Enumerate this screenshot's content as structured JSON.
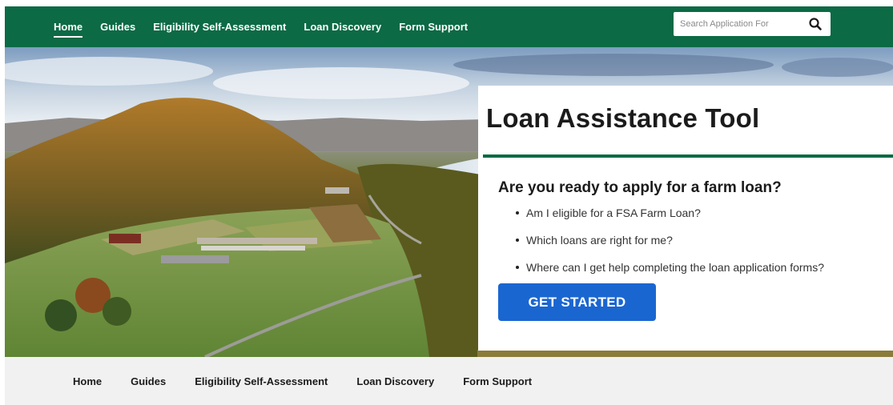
{
  "topnav": {
    "items": [
      {
        "label": "Home",
        "active": true
      },
      {
        "label": "Guides"
      },
      {
        "label": "Eligibility Self-Assessment"
      },
      {
        "label": "Loan Discovery"
      },
      {
        "label": "Form Support"
      }
    ],
    "search": {
      "placeholder": "Search Application For",
      "button_icon": "search-icon"
    }
  },
  "hero": {
    "image": "aerial farm landscape with mountain and river",
    "card": {
      "title": "Loan Assistance Tool",
      "question": "Are you ready to apply for a farm loan?",
      "bullets": [
        "Am I eligible for a FSA Farm Loan?",
        "Which loans are right for me?",
        "Where can I get help completing the loan application forms?"
      ],
      "cta_label": "GET STARTED"
    }
  },
  "footnav": {
    "items": [
      {
        "label": "Home"
      },
      {
        "label": "Guides"
      },
      {
        "label": "Eligibility Self-Assessment"
      },
      {
        "label": "Loan Discovery"
      },
      {
        "label": "Form Support"
      }
    ]
  },
  "colors": {
    "brand_green": "#0c6a45",
    "cta_blue": "#1a66d1",
    "footer_bg": "#f1f1f1"
  }
}
